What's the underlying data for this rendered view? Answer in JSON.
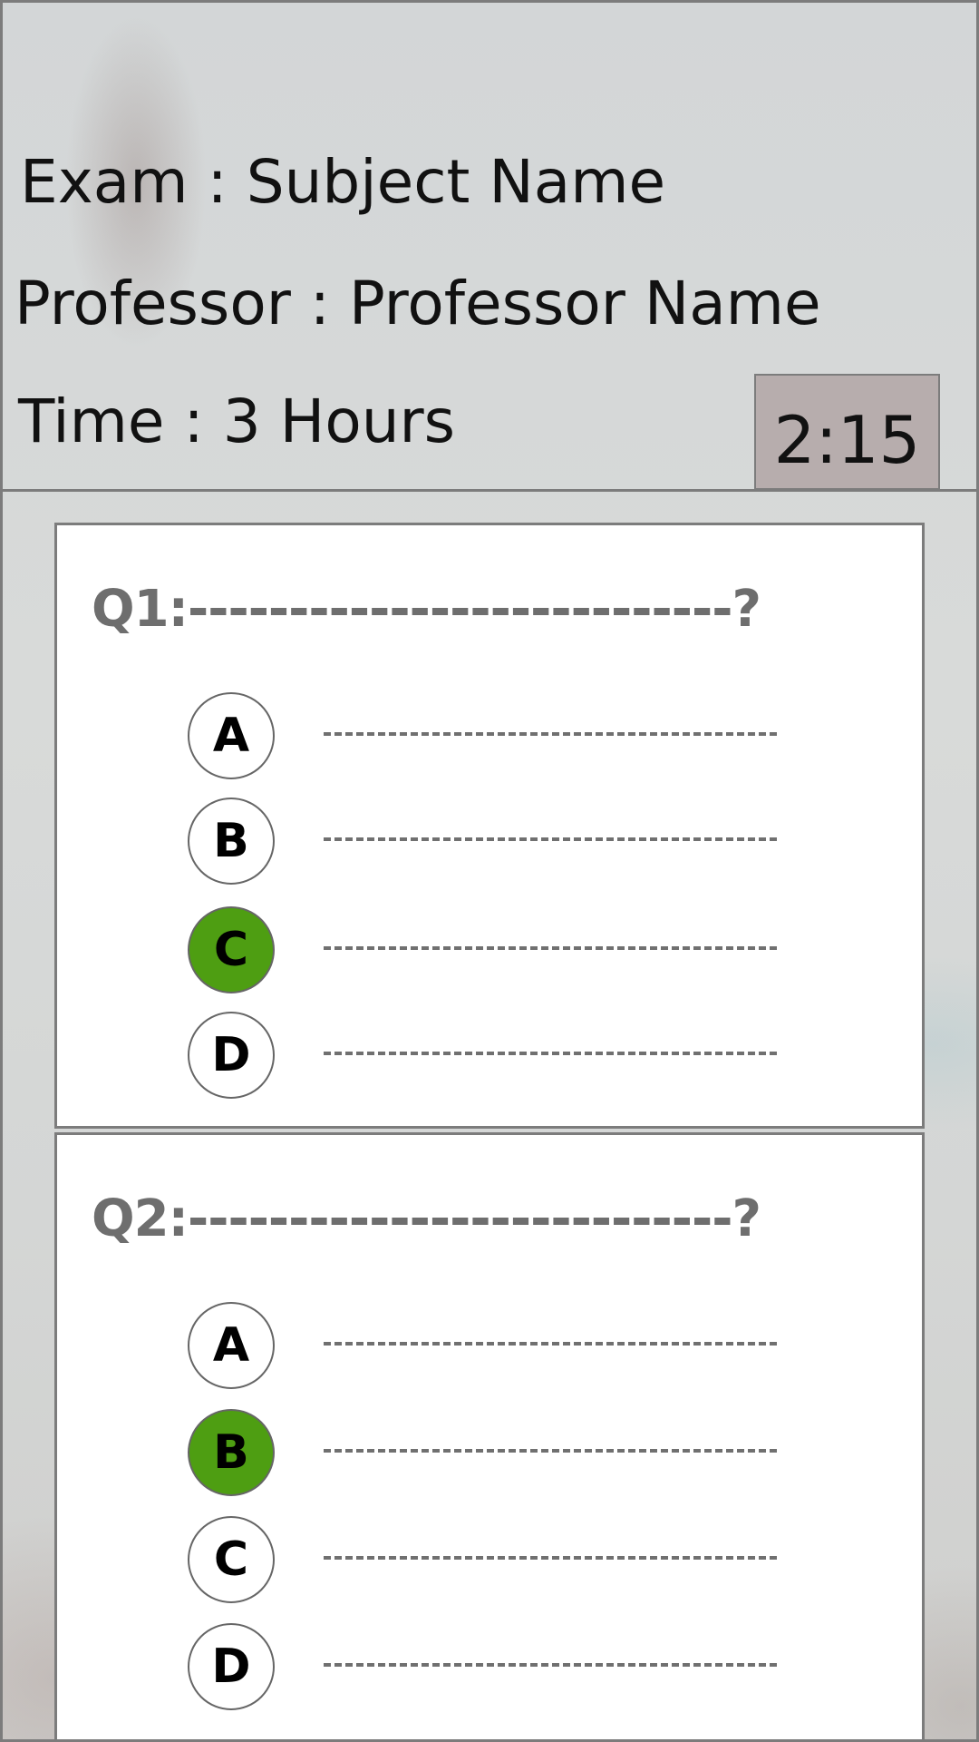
{
  "header": {
    "exam": "Exam : Subject Name",
    "professor": "Professor : Professor Name",
    "time": "Time : 3 Hours",
    "timer": "2:15"
  },
  "questions": [
    {
      "title": "Q1:---------------------------?",
      "options": [
        {
          "letter": "A",
          "selected": false
        },
        {
          "letter": "B",
          "selected": false
        },
        {
          "letter": "C",
          "selected": true
        },
        {
          "letter": "D",
          "selected": false
        }
      ]
    },
    {
      "title": "Q2:---------------------------?",
      "options": [
        {
          "letter": "A",
          "selected": false
        },
        {
          "letter": "B",
          "selected": true
        },
        {
          "letter": "C",
          "selected": false
        },
        {
          "letter": "D",
          "selected": false
        }
      ]
    }
  ],
  "colors": {
    "selected": "#4e9e12",
    "timer_bg": "#b7adad",
    "border": "#7c7c7c"
  }
}
